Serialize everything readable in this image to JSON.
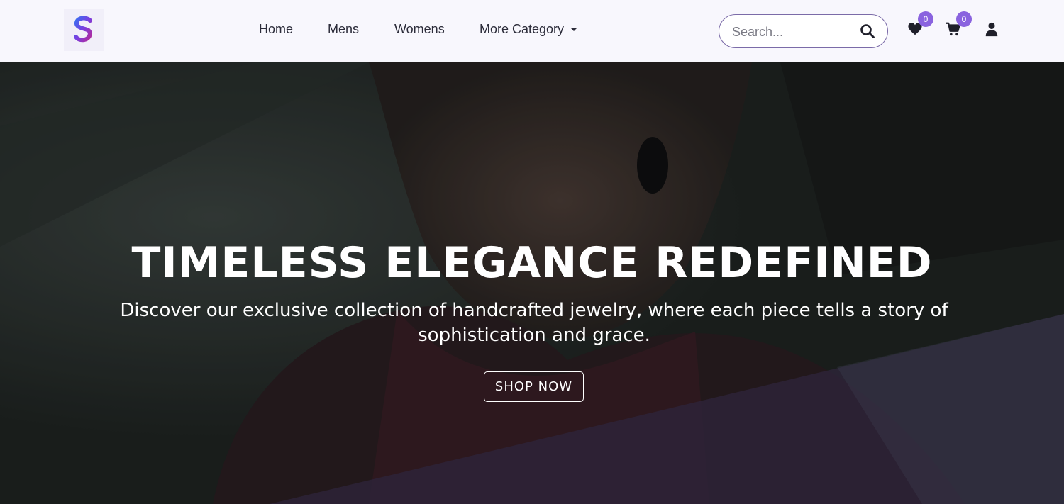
{
  "nav": {
    "logo_name": "s-logo",
    "links": [
      {
        "label": "Home"
      },
      {
        "label": "Mens"
      },
      {
        "label": "Womens"
      },
      {
        "label": "More Category"
      }
    ],
    "search": {
      "placeholder": "Search...",
      "value": ""
    },
    "wishlist": {
      "icon": "heart-icon",
      "count": "0"
    },
    "cart": {
      "icon": "cart-icon",
      "count": "0"
    },
    "account": {
      "icon": "user-icon"
    }
  },
  "hero": {
    "title": "TIMELESS ELEGANCE REDEFINED",
    "subtitle": "Discover our exclusive collection of handcrafted jewelry, where each piece tells a story of sophistication and grace.",
    "cta_label": "SHOP NOW"
  },
  "colors": {
    "accent": "#8a63df",
    "nav_bg": "#f8f7fd",
    "hero_overlay": "#1e2321",
    "hero_band": "#3a2d4a"
  }
}
